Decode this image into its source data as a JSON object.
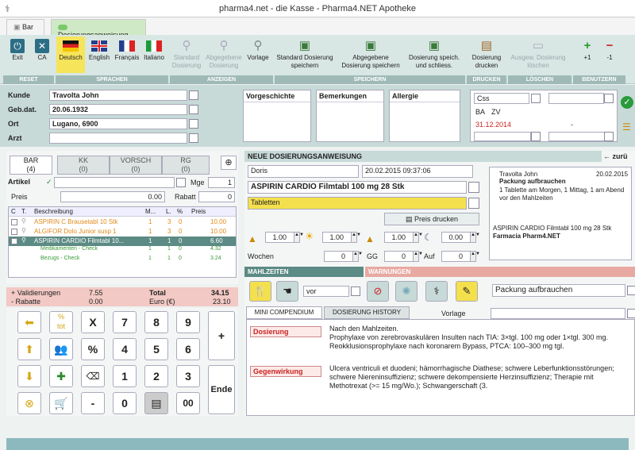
{
  "window": {
    "title": "pharma4.net - die Kasse - Pharma4.NET Apotheke"
  },
  "tabs": [
    {
      "label": "Bar"
    },
    {
      "label": "Dosierungsanweisung"
    }
  ],
  "ribbon": {
    "exit": "Exit",
    "ca": "CA",
    "languages": [
      "Deutsch",
      "English",
      "Français",
      "Italiano"
    ],
    "anzeigen": [
      "Standard Dosierung",
      "Abgegebene Dosierung",
      "Vorlage"
    ],
    "speichern": [
      "Standard Dosierung speichern",
      "Abgegebene Dosierung speichern",
      "Dosierung speich. und schliess."
    ],
    "drucken": "Dosierung drucken",
    "loeschen": "Ausgew. Dosierung löschen",
    "plus": "+1",
    "minus": "-1",
    "groups": {
      "reset": "RESET",
      "sprachen": "SPRACHEN",
      "anzeigen": "ANZEIGEN",
      "speichern": "SPEICHERN",
      "drucken": "DRUCKEN",
      "loeschen": "LÖSCHEN",
      "benutzern": "BENUTZERN"
    }
  },
  "customer": {
    "kunde_label": "Kunde",
    "kunde": "Travolta John",
    "geb_label": "Geb.dat.",
    "geb": "20.06.1932",
    "ort_label": "Ort",
    "ort": "Lugano, 6900",
    "arzt_label": "Arzt",
    "arzt": ""
  },
  "notes": {
    "vorgeschichte": "Vorgeschichte",
    "bemerkungen": "Bemerkungen",
    "allergie": "Allergie"
  },
  "insurance": {
    "css": "Css",
    "ba": "BA",
    "zv": "ZV",
    "date": "31.12.2014",
    "dash": "-"
  },
  "cart_tabs": [
    {
      "label": "BAR",
      "count": "(4)"
    },
    {
      "label": "KK",
      "count": "(0)"
    },
    {
      "label": "VORSCH",
      "count": "(0)"
    },
    {
      "label": "RG",
      "count": "(0)"
    }
  ],
  "artikel": {
    "label": "Artikel",
    "mge_label": "Mge",
    "mge": "1",
    "preis_label": "Preis",
    "preis": "0.00",
    "rabatt_label": "Rabatt",
    "rabatt": "0"
  },
  "cart_cols": [
    "C",
    "T.",
    "Beschreibung",
    "M...",
    "L.",
    "%",
    "Preis"
  ],
  "cart_rows": [
    {
      "desc": "ASPIRIN C Brausetabl 10 Stk",
      "m": "1",
      "l": "3",
      "p": "0",
      "price": "10.00",
      "color": "#e08a1a"
    },
    {
      "desc": "ALGIFOR Dolo Junior susp 1",
      "m": "1",
      "l": "3",
      "p": "0",
      "price": "10.00",
      "color": "#e08a1a"
    },
    {
      "desc": "ASPIRIN CARDIO Filmtabl 10...",
      "m": "1",
      "l": "1",
      "p": "0",
      "price": "6.60",
      "color": "#ffffff"
    },
    {
      "desc": "Medikamenten - Check",
      "m": "1",
      "l": "1",
      "p": "0",
      "price": "4.32",
      "color": "#3a9a3a"
    },
    {
      "desc": "Bezugs - Check",
      "m": "1",
      "l": "1",
      "p": "0",
      "price": "3.24",
      "color": "#3a9a3a"
    }
  ],
  "totals": {
    "valid_label": "+ Validierungen",
    "valid": "7.55",
    "rabatte_label": "- Rabatte",
    "rabatte": "0.00",
    "total_label": "Total",
    "total": "34.15",
    "euro_label": "Euro (€)",
    "euro": "23.10"
  },
  "keypad": {
    "digits": [
      "7",
      "8",
      "9",
      "4",
      "5",
      "6",
      "1",
      "2",
      "3",
      "0",
      "00"
    ],
    "x": "X",
    "pct": "%",
    "minus": "-",
    "plus": "+",
    "ende": "Ende",
    "tot": "tot"
  },
  "dosage": {
    "header": "NEUE DOSIERUNGSANWEISUNG",
    "back": "zurü",
    "name": "Doris",
    "datetime": "20.02.2015 09:37:06",
    "product": "ASPIRIN CARDIO Filmtabl 100 mg 28 Stk",
    "form": "Tabletten",
    "print_price": "Preis drucken",
    "doses": [
      "1.00",
      "1.00",
      "1.00",
      "0.00"
    ],
    "wochen_label": "Wochen",
    "wochen": "0",
    "gg_label": "GG",
    "gg": "0",
    "auf_label": "Auf",
    "auf": "0",
    "mahlzeiten": "MAHLZEITEN",
    "warnungen": "WARNUNGEN",
    "vor": "vor",
    "packung": "Packung aufbrauchen"
  },
  "label_preview": {
    "name": "Travolta John",
    "date": "20.02.2015",
    "title": "Packung aufbrauchen",
    "text": "1 Tablette am Morgen, 1 Mittag, 1 am Abend vor den Mahlzeiten",
    "product": "ASPIRIN CARDIO Filmtabl 100 mg 28 Stk",
    "pharmacy": "Farmacia Pharm4.NET"
  },
  "info_tabs": {
    "mini": "MINI COMPENDIUM",
    "history": "DOSIERUNG HISTORY",
    "vorlage": "Vorlage"
  },
  "compendium": {
    "dosierung_label": "Dosierung",
    "dosierung_text": "Nach den Mahlzeiten.\nProphylaxe von zerebrovaskulären Insulten nach TIA: 3×tgl. 100 mg oder 1×tgl. 300 mg.\nReokklusionsprophylaxe nach koronarem Bypass, PTCA: 100–300 mg tgl.",
    "gegen_label": "Gegenwirkung",
    "gegen_text": "Ulcera ventriculi et duodeni; hämorrhagische Diathese; schwere Leberfunktionsstörungen; schwere Niereninsuffizienz; schwere dekompensierte Herzinsuffizienz; Therapie mit Methotrexat (>= 15 mg/Wo.); Schwangerschaft (3."
  }
}
